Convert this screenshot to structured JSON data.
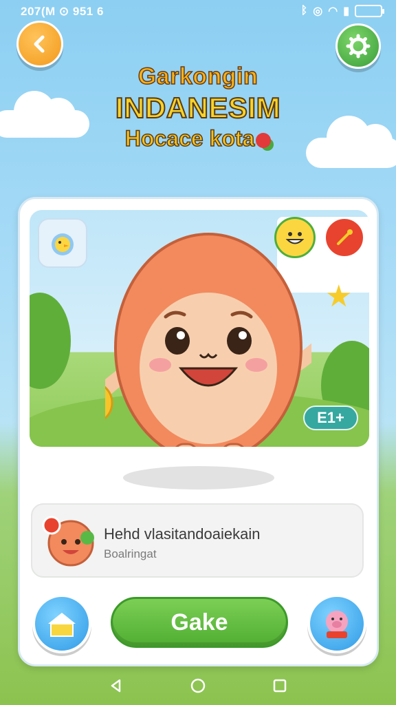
{
  "status_bar": {
    "time": "207(M ⊙ 951 6",
    "icons": [
      "bluetooth-icon",
      "location-icon",
      "wifi-icon",
      "signal-icon",
      "battery-icon"
    ]
  },
  "header": {
    "back_icon": "chevron-left-icon",
    "settings_icon": "gear-icon"
  },
  "title": {
    "line1": "Garkongin",
    "line2": "INDANESIM",
    "line3": "Hocace kota"
  },
  "scene": {
    "level_label": "E1+",
    "badges": [
      "chick-icon",
      "smiley-icon",
      "wand-icon"
    ]
  },
  "info_panel": {
    "title": "Hehd vlasitandoaiekain",
    "subtitle": "Boalringat"
  },
  "actions": {
    "play_label": "Gake",
    "home_icon": "house-icon",
    "pig_icon": "pig-icon"
  },
  "colors": {
    "primary_green": "#4fae32",
    "orange": "#f39a1c",
    "blue": "#2f9be6",
    "teal": "#36a8a0"
  }
}
